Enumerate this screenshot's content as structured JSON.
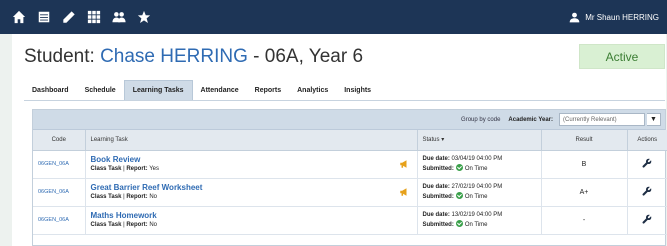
{
  "topbar": {
    "user_name": "Mr Shaun HERRING",
    "icons": [
      "home-icon",
      "grid-icon",
      "pencil-icon",
      "apps-icon",
      "users-icon",
      "star-icon",
      "user-icon"
    ]
  },
  "student": {
    "prefix": "Student: ",
    "name": "Chase HERRING",
    "suffix": " - 06A, Year 6",
    "status": "Active"
  },
  "tabs": [
    {
      "label": "Dashboard",
      "active": false
    },
    {
      "label": "Schedule",
      "active": false
    },
    {
      "label": "Learning Tasks",
      "active": true
    },
    {
      "label": "Attendance",
      "active": false
    },
    {
      "label": "Reports",
      "active": false
    },
    {
      "label": "Analytics",
      "active": false
    },
    {
      "label": "Insights",
      "active": false
    }
  ],
  "filter": {
    "group_by": "Group by code",
    "year_label": "Academic Year:",
    "year_value": "(Currently Relevant)"
  },
  "table": {
    "headers": {
      "code": "Code",
      "task": "Learning Task",
      "status": "Status",
      "result": "Result",
      "actions": "Actions"
    },
    "rows": [
      {
        "code": "06GEN_06A",
        "title": "Book Review",
        "type": "Class Task",
        "report_label": "Report:",
        "report": "Yes",
        "due_label": "Due date:",
        "due": "03/04/19 04:00 PM",
        "sub_label": "Submitted:",
        "sub": "On Time",
        "result": "B"
      },
      {
        "code": "06GEN_06A",
        "title": "Great Barrier Reef Worksheet",
        "type": "Class Task",
        "report_label": "Report:",
        "report": "No",
        "due_label": "Due date:",
        "due": "27/02/19 04:00 PM",
        "sub_label": "Submitted:",
        "sub": "On Time",
        "result": "A+"
      },
      {
        "code": "06GEN_06A",
        "title": "Maths Homework",
        "type": "Class Task",
        "report_label": "Report:",
        "report": "No",
        "due_label": "Due date:",
        "due": "13/02/19 04:00 PM",
        "sub_label": "Submitted:",
        "sub": "On Time",
        "result": "-"
      }
    ]
  },
  "colors": {
    "topbar": "#1d3556",
    "link": "#2f6bb3",
    "active_badge_bg": "#d9f0d3",
    "active_badge_text": "#3b7d33",
    "flag": "#e6a11b",
    "ok": "#3aa04a"
  }
}
